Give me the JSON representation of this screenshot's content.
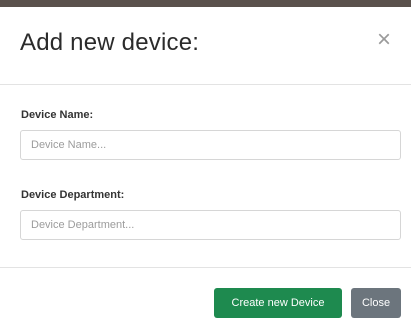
{
  "modal": {
    "title": "Add new device:",
    "close_icon": "close-icon"
  },
  "form": {
    "name_label": "Device Name:",
    "name_placeholder": "Device Name...",
    "department_label": "Device Department:",
    "department_placeholder": "Device Department..."
  },
  "footer": {
    "create_label": "Create new Device",
    "close_label": "Close"
  },
  "colors": {
    "primary": "#1e8a4f",
    "secondary": "#6c757d",
    "backdrop": "#5a514c"
  }
}
